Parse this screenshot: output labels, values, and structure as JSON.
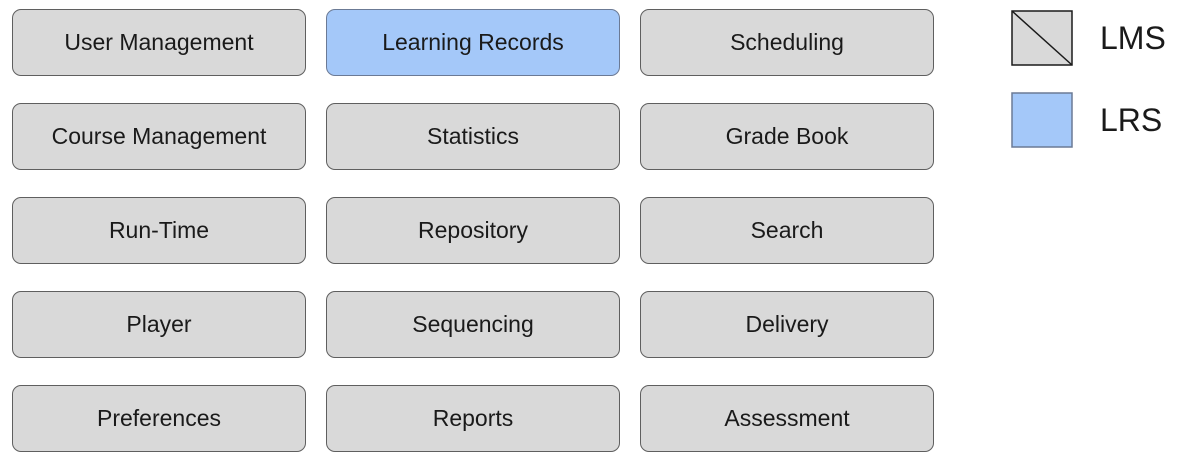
{
  "modules": [
    {
      "label": "User Management",
      "system": "LMS"
    },
    {
      "label": "Learning Records",
      "system": "LRS"
    },
    {
      "label": "Scheduling",
      "system": "LMS"
    },
    {
      "label": "Course Management",
      "system": "LMS"
    },
    {
      "label": "Statistics",
      "system": "LMS"
    },
    {
      "label": "Grade Book",
      "system": "LMS"
    },
    {
      "label": "Run-Time",
      "system": "LMS"
    },
    {
      "label": "Repository",
      "system": "LMS"
    },
    {
      "label": "Search",
      "system": "LMS"
    },
    {
      "label": "Player",
      "system": "LMS"
    },
    {
      "label": "Sequencing",
      "system": "LMS"
    },
    {
      "label": "Delivery",
      "system": "LMS"
    },
    {
      "label": "Preferences",
      "system": "LMS"
    },
    {
      "label": "Reports",
      "system": "LMS"
    },
    {
      "label": "Assessment",
      "system": "LMS"
    }
  ],
  "legend": {
    "lms": {
      "label": "LMS",
      "color": "#d9d9d9"
    },
    "lrs": {
      "label": "LRS",
      "color": "#a4c8f9"
    }
  }
}
